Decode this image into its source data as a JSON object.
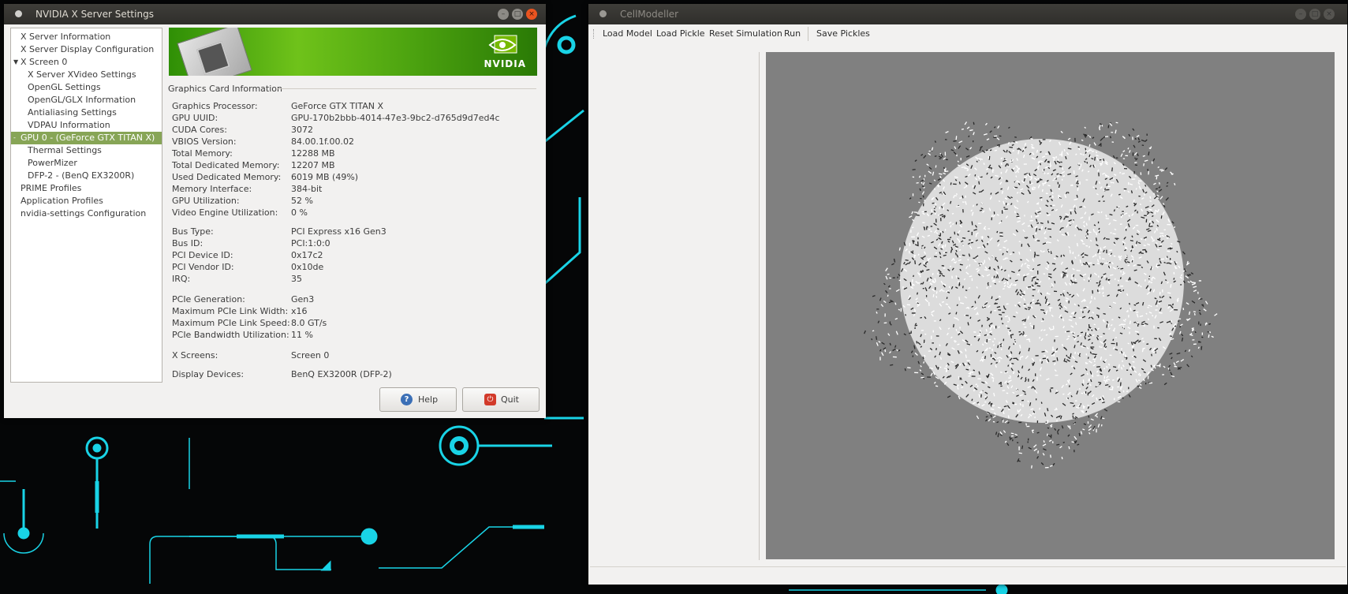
{
  "nvidia_window": {
    "title": "NVIDIA X Server Settings",
    "tree_items": [
      {
        "label": "X Server Information",
        "level": 1
      },
      {
        "label": "X Server Display Configuration",
        "level": 1
      },
      {
        "label": "X Screen 0",
        "level": 1,
        "expanded": true
      },
      {
        "label": "X Server XVideo Settings",
        "level": 2
      },
      {
        "label": "OpenGL Settings",
        "level": 2
      },
      {
        "label": "OpenGL/GLX Information",
        "level": 2
      },
      {
        "label": "Antialiasing Settings",
        "level": 2
      },
      {
        "label": "VDPAU Information",
        "level": 2
      },
      {
        "label": "GPU 0 - (GeForce GTX TITAN X)",
        "level": 1,
        "selected": true,
        "expanded": true
      },
      {
        "label": "Thermal Settings",
        "level": 2
      },
      {
        "label": "PowerMizer",
        "level": 2
      },
      {
        "label": "DFP-2 - (BenQ EX3200R)",
        "level": 2
      },
      {
        "label": "PRIME Profiles",
        "level": 1
      },
      {
        "label": "Application Profiles",
        "level": 1
      },
      {
        "label": "nvidia-settings Configuration",
        "level": 1
      }
    ],
    "banner_logo_text": "NVIDIA",
    "section_title": "Graphics Card Information",
    "info_groups": [
      [
        {
          "label": "Graphics Processor:",
          "value": "GeForce GTX TITAN X"
        },
        {
          "label": "GPU UUID:",
          "value": "GPU-170b2bbb-4014-47e3-9bc2-d765d9d7ed4c"
        },
        {
          "label": "CUDA Cores:",
          "value": "3072"
        },
        {
          "label": "VBIOS Version:",
          "value": "84.00.1f.00.02"
        },
        {
          "label": "Total Memory:",
          "value": "12288 MB"
        },
        {
          "label": "Total Dedicated Memory:",
          "value": "12207 MB"
        },
        {
          "label": "Used Dedicated Memory:",
          "value": "6019 MB (49%)"
        },
        {
          "label": "Memory Interface:",
          "value": "384-bit"
        },
        {
          "label": "GPU Utilization:",
          "value": "52 %"
        },
        {
          "label": "Video Engine Utilization:",
          "value": "0 %"
        }
      ],
      [
        {
          "label": "Bus Type:",
          "value": "PCI Express x16 Gen3"
        },
        {
          "label": "Bus ID:",
          "value": "PCI:1:0:0"
        },
        {
          "label": "PCI Device ID:",
          "value": "0x17c2"
        },
        {
          "label": "PCI Vendor ID:",
          "value": "0x10de"
        },
        {
          "label": "IRQ:",
          "value": "35"
        }
      ],
      [
        {
          "label": "PCIe Generation:",
          "value": "Gen3"
        },
        {
          "label": "Maximum PCIe Link Width:",
          "value": "x16"
        },
        {
          "label": "Maximum PCIe Link Speed:",
          "value": "8.0 GT/s"
        },
        {
          "label": "PCIe Bandwidth Utilization:",
          "value": "11 %"
        }
      ],
      [
        {
          "label": "X Screens:",
          "value": "Screen 0"
        }
      ],
      [
        {
          "label": "Display Devices:",
          "value": "BenQ EX3200R (DFP-2)"
        }
      ]
    ],
    "help_label": "Help",
    "quit_label": "Quit",
    "help_icon": "question-icon",
    "quit_icon": "power-icon"
  },
  "cellmodeller_window": {
    "title": "CellModeller",
    "toolbar": {
      "load_model": "Load Model",
      "load_pickle": "Load Pickle",
      "reset_simulation": "Reset Simulation",
      "run": "Run",
      "save_pickles": "Save Pickles"
    },
    "canvas_bg": "#808080"
  },
  "colors": {
    "desktop_bg": "#050607",
    "circuit_accent": "#19d3e6",
    "nvidia_green": "#76b900",
    "selection": "#87a556",
    "close_button": "#e95420"
  }
}
